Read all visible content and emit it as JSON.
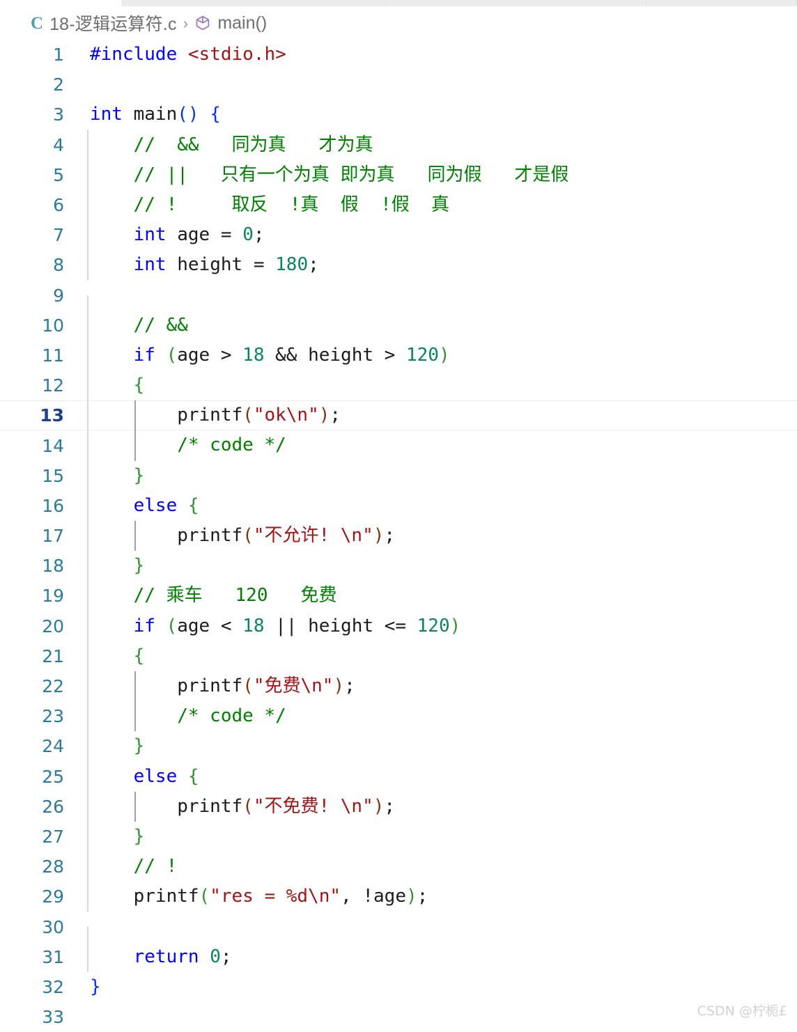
{
  "window": {
    "tab_strip_slots": [
      245,
      525,
      520,
      300
    ]
  },
  "breadcrumb": {
    "file_icon_letter": "C",
    "file_name": "18-逻辑运算符.c",
    "separator": "›",
    "symbol_icon": "cube-symbol-icon",
    "symbol_name": "main()"
  },
  "editor": {
    "language": "c",
    "current_line": 13,
    "total_lines": 33,
    "watermark": "CSDN @柠栀£",
    "lines": [
      {
        "n": 1,
        "guides": [],
        "tokens": [
          {
            "t": "#include ",
            "c": "inc"
          },
          {
            "t": "<stdio.h>",
            "c": "hdr"
          }
        ]
      },
      {
        "n": 2,
        "guides": [],
        "tokens": []
      },
      {
        "n": 3,
        "guides": [],
        "tokens": [
          {
            "t": "int",
            "c": "kw"
          },
          {
            "t": " main",
            "c": "plain"
          },
          {
            "t": "()",
            "c": "b0"
          },
          {
            "t": " ",
            "c": "plain"
          },
          {
            "t": "{",
            "c": "b0"
          }
        ]
      },
      {
        "n": 4,
        "guides": [
          0
        ],
        "tokens": [
          {
            "t": "    //  &&   同为真   才为真",
            "c": "cmt"
          }
        ]
      },
      {
        "n": 5,
        "guides": [
          0
        ],
        "tokens": [
          {
            "t": "    // ||   只有一个为真 即为真   同为假   才是假",
            "c": "cmt"
          }
        ]
      },
      {
        "n": 6,
        "guides": [
          0
        ],
        "tokens": [
          {
            "t": "    // !     取反  !真  假  !假  真",
            "c": "cmt"
          }
        ]
      },
      {
        "n": 7,
        "guides": [
          0
        ],
        "tokens": [
          {
            "t": "    ",
            "c": "plain"
          },
          {
            "t": "int",
            "c": "kw"
          },
          {
            "t": " age ",
            "c": "plain"
          },
          {
            "t": "=",
            "c": "plain"
          },
          {
            "t": " ",
            "c": "plain"
          },
          {
            "t": "0",
            "c": "num"
          },
          {
            "t": ";",
            "c": "plain"
          }
        ]
      },
      {
        "n": 8,
        "guides": [
          0
        ],
        "tokens": [
          {
            "t": "    ",
            "c": "plain"
          },
          {
            "t": "int",
            "c": "kw"
          },
          {
            "t": " height ",
            "c": "plain"
          },
          {
            "t": "=",
            "c": "plain"
          },
          {
            "t": " ",
            "c": "plain"
          },
          {
            "t": "180",
            "c": "num"
          },
          {
            "t": ";",
            "c": "plain"
          }
        ]
      },
      {
        "n": 9,
        "guides": [
          0
        ],
        "tokens": []
      },
      {
        "n": 10,
        "guides": [
          0
        ],
        "tokens": [
          {
            "t": "    // &&",
            "c": "cmt"
          }
        ]
      },
      {
        "n": 11,
        "guides": [
          0
        ],
        "tokens": [
          {
            "t": "    ",
            "c": "plain"
          },
          {
            "t": "if",
            "c": "kw"
          },
          {
            "t": " ",
            "c": "plain"
          },
          {
            "t": "(",
            "c": "b1"
          },
          {
            "t": "age > ",
            "c": "plain"
          },
          {
            "t": "18",
            "c": "num"
          },
          {
            "t": " && height > ",
            "c": "plain"
          },
          {
            "t": "120",
            "c": "num"
          },
          {
            "t": ")",
            "c": "b1"
          }
        ]
      },
      {
        "n": 12,
        "guides": [
          0
        ],
        "tokens": [
          {
            "t": "    ",
            "c": "plain"
          },
          {
            "t": "{",
            "c": "b1"
          }
        ]
      },
      {
        "n": 13,
        "guides": [
          0,
          1
        ],
        "current": true,
        "tokens": [
          {
            "t": "        printf",
            "c": "plain"
          },
          {
            "t": "(",
            "c": "b2"
          },
          {
            "t": "\"ok\\n\"",
            "c": "str"
          },
          {
            "t": ")",
            "c": "b2"
          },
          {
            "t": ";",
            "c": "plain"
          }
        ]
      },
      {
        "n": 14,
        "guides": [
          0,
          1
        ],
        "tokens": [
          {
            "t": "        /* code */",
            "c": "cmt"
          }
        ]
      },
      {
        "n": 15,
        "guides": [
          0
        ],
        "tokens": [
          {
            "t": "    ",
            "c": "plain"
          },
          {
            "t": "}",
            "c": "b1"
          }
        ]
      },
      {
        "n": 16,
        "guides": [
          0
        ],
        "tokens": [
          {
            "t": "    ",
            "c": "plain"
          },
          {
            "t": "else",
            "c": "kw"
          },
          {
            "t": " ",
            "c": "plain"
          },
          {
            "t": "{",
            "c": "b1"
          }
        ]
      },
      {
        "n": 17,
        "guides": [
          0,
          1
        ],
        "tokens": [
          {
            "t": "        printf",
            "c": "plain"
          },
          {
            "t": "(",
            "c": "b2"
          },
          {
            "t": "\"不允许! \\n\"",
            "c": "str"
          },
          {
            "t": ")",
            "c": "b2"
          },
          {
            "t": ";",
            "c": "plain"
          }
        ]
      },
      {
        "n": 18,
        "guides": [
          0
        ],
        "tokens": [
          {
            "t": "    ",
            "c": "plain"
          },
          {
            "t": "}",
            "c": "b1"
          }
        ]
      },
      {
        "n": 19,
        "guides": [
          0
        ],
        "tokens": [
          {
            "t": "    // 乘车   120   免费",
            "c": "cmt"
          }
        ]
      },
      {
        "n": 20,
        "guides": [
          0
        ],
        "tokens": [
          {
            "t": "    ",
            "c": "plain"
          },
          {
            "t": "if",
            "c": "kw"
          },
          {
            "t": " ",
            "c": "plain"
          },
          {
            "t": "(",
            "c": "b1"
          },
          {
            "t": "age < ",
            "c": "plain"
          },
          {
            "t": "18",
            "c": "num"
          },
          {
            "t": " || height <= ",
            "c": "plain"
          },
          {
            "t": "120",
            "c": "num"
          },
          {
            "t": ")",
            "c": "b1"
          }
        ]
      },
      {
        "n": 21,
        "guides": [
          0
        ],
        "tokens": [
          {
            "t": "    ",
            "c": "plain"
          },
          {
            "t": "{",
            "c": "b1"
          }
        ]
      },
      {
        "n": 22,
        "guides": [
          0,
          1
        ],
        "tokens": [
          {
            "t": "        printf",
            "c": "plain"
          },
          {
            "t": "(",
            "c": "b2"
          },
          {
            "t": "\"免费\\n\"",
            "c": "str"
          },
          {
            "t": ")",
            "c": "b2"
          },
          {
            "t": ";",
            "c": "plain"
          }
        ]
      },
      {
        "n": 23,
        "guides": [
          0,
          1
        ],
        "tokens": [
          {
            "t": "        /* code */",
            "c": "cmt"
          }
        ]
      },
      {
        "n": 24,
        "guides": [
          0
        ],
        "tokens": [
          {
            "t": "    ",
            "c": "plain"
          },
          {
            "t": "}",
            "c": "b1"
          }
        ]
      },
      {
        "n": 25,
        "guides": [
          0
        ],
        "tokens": [
          {
            "t": "    ",
            "c": "plain"
          },
          {
            "t": "else",
            "c": "kw"
          },
          {
            "t": " ",
            "c": "plain"
          },
          {
            "t": "{",
            "c": "b1"
          }
        ]
      },
      {
        "n": 26,
        "guides": [
          0,
          1
        ],
        "tokens": [
          {
            "t": "        printf",
            "c": "plain"
          },
          {
            "t": "(",
            "c": "b2"
          },
          {
            "t": "\"不免费! \\n\"",
            "c": "str"
          },
          {
            "t": ")",
            "c": "b2"
          },
          {
            "t": ";",
            "c": "plain"
          }
        ]
      },
      {
        "n": 27,
        "guides": [
          0
        ],
        "tokens": [
          {
            "t": "    ",
            "c": "plain"
          },
          {
            "t": "}",
            "c": "b1"
          }
        ]
      },
      {
        "n": 28,
        "guides": [
          0
        ],
        "tokens": [
          {
            "t": "    // !",
            "c": "cmt"
          }
        ]
      },
      {
        "n": 29,
        "guides": [
          0
        ],
        "tokens": [
          {
            "t": "    printf",
            "c": "plain"
          },
          {
            "t": "(",
            "c": "b1"
          },
          {
            "t": "\"res = %d\\n\"",
            "c": "str"
          },
          {
            "t": ", !age",
            "c": "plain"
          },
          {
            "t": ")",
            "c": "b1"
          },
          {
            "t": ";",
            "c": "plain"
          }
        ]
      },
      {
        "n": 30,
        "guides": [
          0
        ],
        "tokens": []
      },
      {
        "n": 31,
        "guides": [
          0
        ],
        "tokens": [
          {
            "t": "    ",
            "c": "plain"
          },
          {
            "t": "return",
            "c": "kw"
          },
          {
            "t": " ",
            "c": "plain"
          },
          {
            "t": "0",
            "c": "num"
          },
          {
            "t": ";",
            "c": "plain"
          }
        ]
      },
      {
        "n": 32,
        "guides": [],
        "tokens": [
          {
            "t": "",
            "c": "plain"
          },
          {
            "t": "}",
            "c": "b0"
          }
        ]
      },
      {
        "n": 33,
        "guides": [],
        "tokens": []
      }
    ]
  }
}
